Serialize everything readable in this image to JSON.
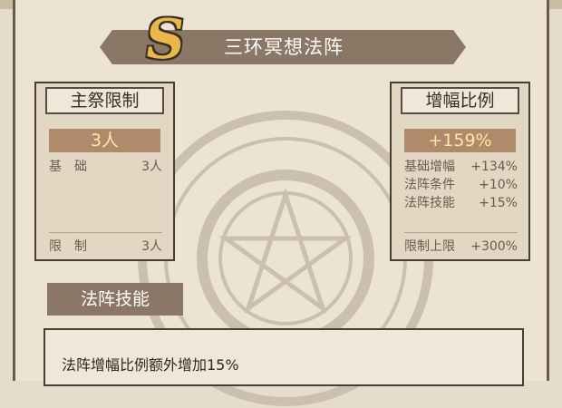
{
  "title": {
    "rank_badge": "S",
    "name": "三环冥想法阵"
  },
  "left_panel": {
    "header": "主祭限制",
    "value": "3人",
    "rows": [
      {
        "label": "基　础",
        "value": "3人"
      }
    ],
    "footer": {
      "label": "限　制",
      "value": "3人"
    }
  },
  "right_panel": {
    "header": "增幅比例",
    "value": "+159%",
    "rows": [
      {
        "label": "基础增幅",
        "value": "+134%"
      },
      {
        "label": "法阵条件",
        "value": "+10%"
      },
      {
        "label": "法阵技能",
        "value": "+15%"
      }
    ],
    "footer": {
      "label": "限制上限",
      "value": "+300%"
    }
  },
  "skill": {
    "tab_label": "法阵技能",
    "description": "法阵增幅比例额外增加15%"
  },
  "colors": {
    "banner": "#8a7766",
    "value_bar": "#b08a6a",
    "value_text": "#ffe9a8",
    "badge": "#e8b84a"
  }
}
